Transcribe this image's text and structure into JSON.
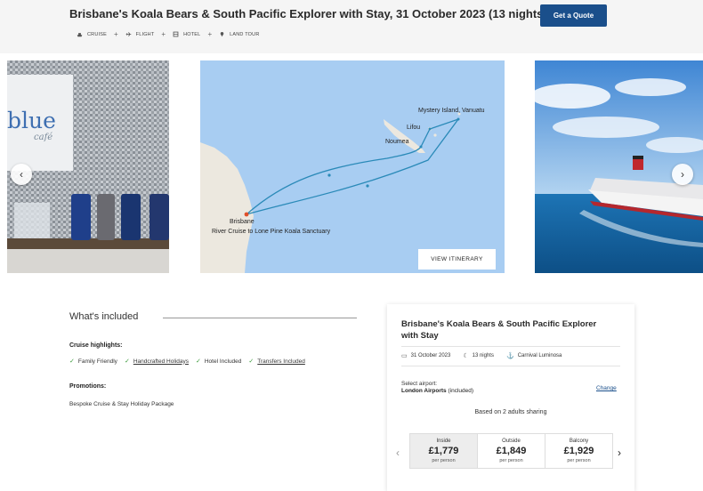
{
  "header": {
    "title": "Brisbane's Koala Bears & South Pacific Explorer with Stay, 31 October 2023 (13 nights)",
    "quote_button": "Get a Quote",
    "tags": [
      {
        "icon": "ship-icon",
        "label": "CRUISE"
      },
      {
        "icon": "plane-icon",
        "label": "FLIGHT"
      },
      {
        "icon": "hotel-icon",
        "label": "HOTEL"
      },
      {
        "icon": "pin-icon",
        "label": "LAND TOUR"
      }
    ],
    "tag_separator": "+"
  },
  "gallery": {
    "panel1_sign_text": "blue",
    "panel1_sign_sub": "café",
    "map_labels": {
      "mystery": "Mystery Island, Vanuatu",
      "lifou": "Lifou",
      "noumea": "Noumea",
      "brisbane": "Brisbane",
      "koala": "River Cruise to Lone Pine Koala Sanctuary"
    },
    "view_itinerary": "VIEW ITINERARY",
    "prev_arrow": "‹",
    "next_arrow": "›"
  },
  "included": {
    "title": "What's included",
    "highlights_label": "Cruise highlights:",
    "highlights": [
      {
        "label": "Family Friendly",
        "underlined": false
      },
      {
        "label": "Handcrafted Holidays",
        "underlined": true
      },
      {
        "label": "Hotel Included",
        "underlined": false
      },
      {
        "label": "Transfers Included",
        "underlined": true
      }
    ],
    "check": "✓",
    "promotions_label": "Promotions:",
    "promotion": "Bespoke Cruise & Stay Holiday Package"
  },
  "card": {
    "title": "Brisbane's Koala Bears & South Pacific Explorer with Stay",
    "date": "31 October 2023",
    "nights": "13 nights",
    "ship": "Carnival Luminosa",
    "airport_label": "Select airport:",
    "airport_name": "London Airports",
    "airport_note": " (included)",
    "change": "Change",
    "based_on": "Based on 2 adults sharing",
    "prices": [
      {
        "category": "Inside",
        "amount": "£1,779",
        "per": "per person",
        "selected": true
      },
      {
        "category": "Outside",
        "amount": "£1,849",
        "per": "per person",
        "selected": false
      },
      {
        "category": "Balcony",
        "amount": "£1,929",
        "per": "per person",
        "selected": false
      }
    ],
    "prev_cabin": "‹",
    "next_cabin": "›"
  },
  "colors": {
    "brand_blue": "#1a4f8b",
    "check_green": "#3a9a3a",
    "map_sea": "#a8cdf2",
    "route": "#2a8ab8"
  }
}
